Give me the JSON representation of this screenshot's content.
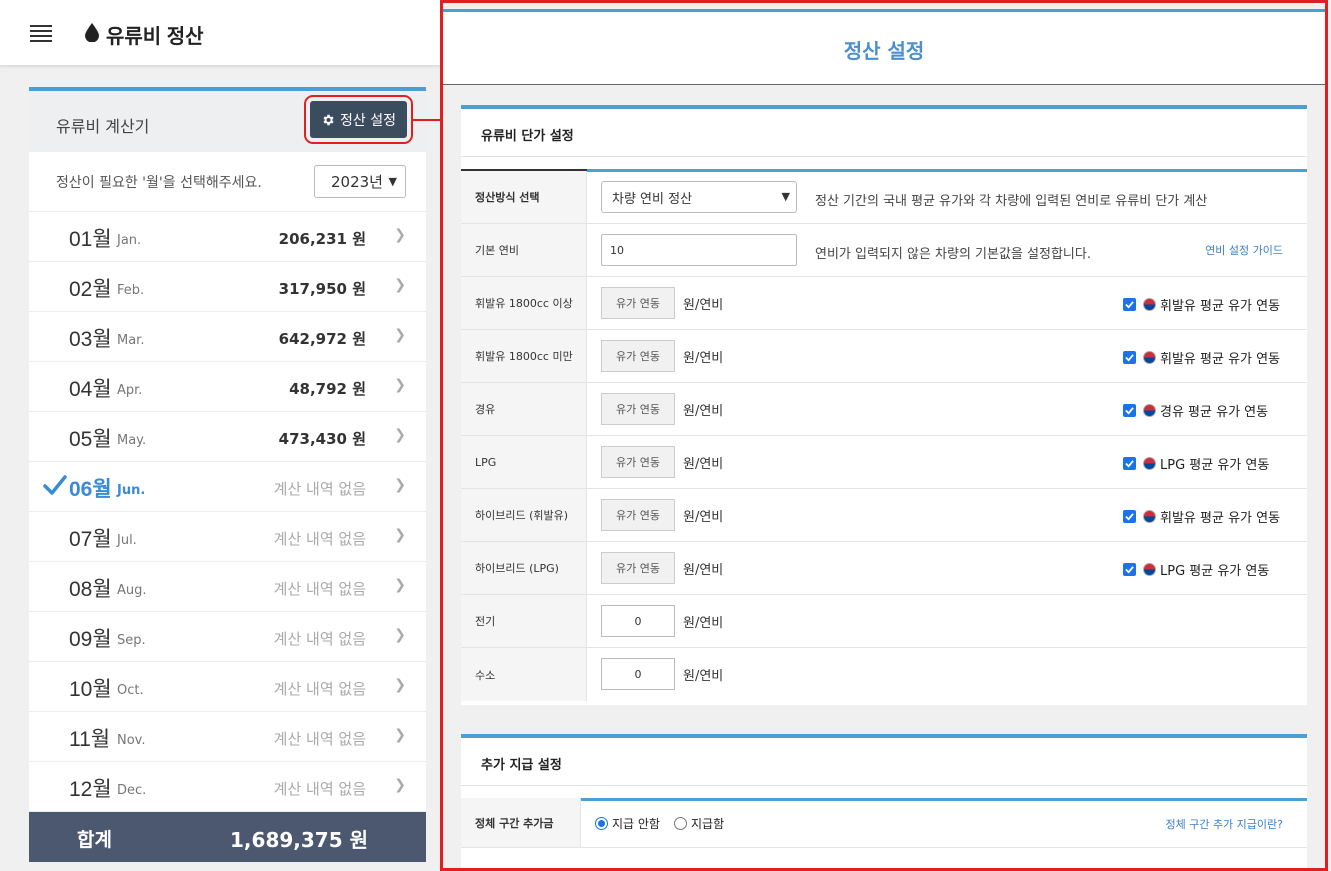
{
  "header": {
    "app_title": "유류비 정산"
  },
  "calculator": {
    "title": "유류비 계산기",
    "settle_button": "정산 설정",
    "year_prompt": "정산이 필요한 '월'을 선택해주세요.",
    "year_value": "2023년",
    "months": [
      {
        "num": "01월",
        "en": "Jan.",
        "value": "206,231 원",
        "empty": false
      },
      {
        "num": "02월",
        "en": "Feb.",
        "value": "317,950 원",
        "empty": false
      },
      {
        "num": "03월",
        "en": "Mar.",
        "value": "642,972 원",
        "empty": false
      },
      {
        "num": "04월",
        "en": "Apr.",
        "value": "48,792 원",
        "empty": false
      },
      {
        "num": "05월",
        "en": "May.",
        "value": "473,430 원",
        "empty": false
      },
      {
        "num": "06월",
        "en": "Jun.",
        "value": "계산 내역 없음",
        "empty": true
      },
      {
        "num": "07월",
        "en": "Jul.",
        "value": "계산 내역 없음",
        "empty": true
      },
      {
        "num": "08월",
        "en": "Aug.",
        "value": "계산 내역 없음",
        "empty": true
      },
      {
        "num": "09월",
        "en": "Sep.",
        "value": "계산 내역 없음",
        "empty": true
      },
      {
        "num": "10월",
        "en": "Oct.",
        "value": "계산 내역 없음",
        "empty": true
      },
      {
        "num": "11월",
        "en": "Nov.",
        "value": "계산 내역 없음",
        "empty": true
      },
      {
        "num": "12월",
        "en": "Dec.",
        "value": "계산 내역 없음",
        "empty": true
      }
    ],
    "total_label": "합계",
    "total_value": "1,689,375 원"
  },
  "settings": {
    "title": "정산 설정",
    "unit_price": {
      "title": "유류비 단가 설정",
      "method_label": "정산방식 선택",
      "method_value": "차량 연비 정산",
      "method_desc": "정산 기간의 국내 평균 유가와 각 차량에 입력된 연비로 유류비 단가 계산",
      "base_eff_label": "기본 연비",
      "base_eff_value": "10",
      "base_eff_desc": "연비가 입력되지 않은 차량의 기본값을 설정합니다.",
      "base_eff_link": "연비 설정 가이드",
      "fuel_button": "유가 연동",
      "unit": "원/연비",
      "fuels": [
        {
          "label": "휘발유 1800cc 이상",
          "link": "휘발유 평균 유가 연동"
        },
        {
          "label": "휘발유 1800cc 미만",
          "link": "휘발유 평균 유가 연동"
        },
        {
          "label": "경유",
          "link": "경유 평균 유가 연동"
        },
        {
          "label": "LPG",
          "link": "LPG 평균 유가 연동"
        },
        {
          "label": "하이브리드 (휘발유)",
          "link": "휘발유 평균 유가 연동"
        },
        {
          "label": "하이브리드 (LPG)",
          "link": "LPG 평균 유가 연동"
        }
      ],
      "electric_label": "전기",
      "electric_value": "0",
      "hydrogen_label": "수소",
      "hydrogen_value": "0"
    },
    "extra": {
      "title": "추가 지급 설정",
      "congestion_label": "정체 구간 추가금",
      "opt_no": "지급 안함",
      "opt_yes": "지급함",
      "congestion_link": "정체 구간 추가 지급이란?"
    }
  },
  "colors": {
    "accent": "#4a9fd6",
    "highlight": "#e02020",
    "dark_button": "#3c4c5f",
    "total_bg": "#4c5870"
  }
}
